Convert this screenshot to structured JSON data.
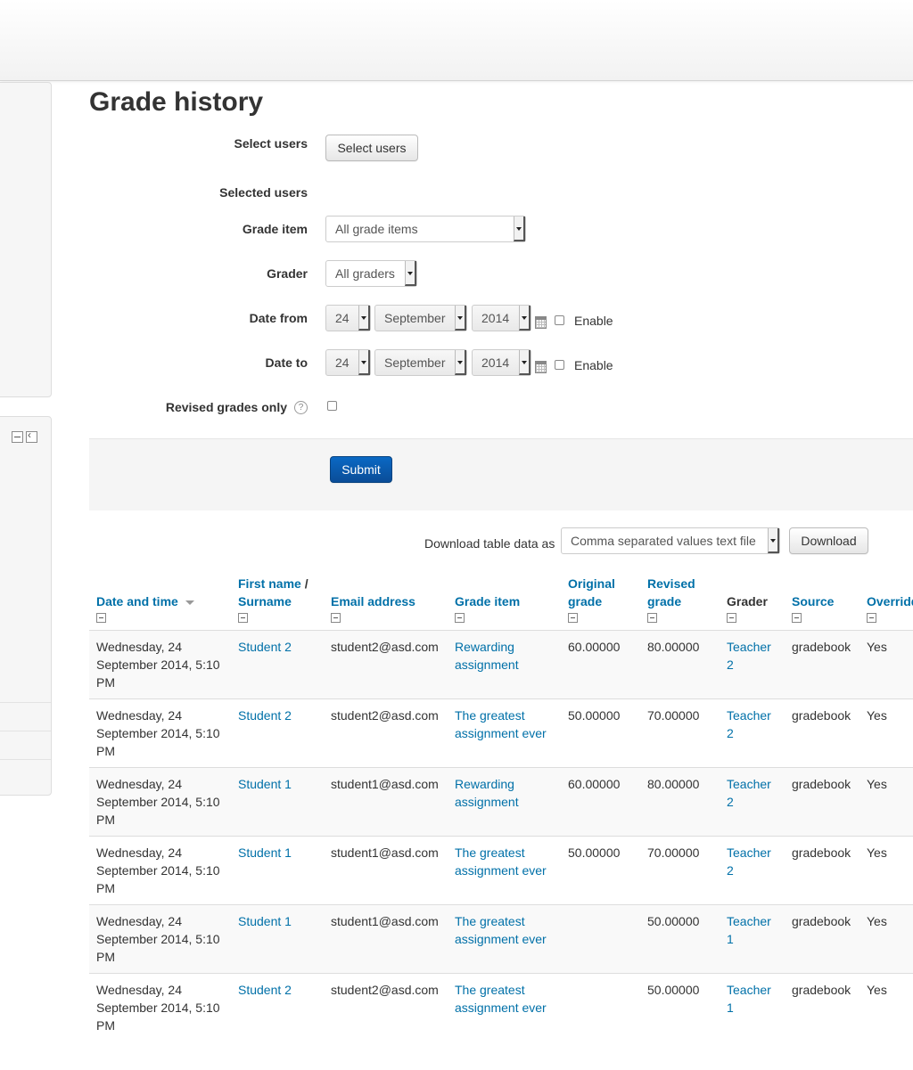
{
  "page": {
    "title": "Grade history"
  },
  "form": {
    "select_users_label": "Select users",
    "select_users_button": "Select users",
    "selected_users_label": "Selected users",
    "grade_item_label": "Grade item",
    "grade_item_value": "All grade items",
    "grader_label": "Grader",
    "grader_value": "All graders",
    "date_from_label": "Date from",
    "date_from": {
      "day": "24",
      "month": "September",
      "year": "2014",
      "enable_label": "Enable"
    },
    "date_to_label": "Date to",
    "date_to": {
      "day": "24",
      "month": "September",
      "year": "2014",
      "enable_label": "Enable"
    },
    "revised_grades_label": "Revised grades only",
    "help_icon": "?",
    "submit_label": "Submit"
  },
  "download": {
    "label": "Download table data as",
    "format_value": "Comma separated values text file",
    "button": "Download"
  },
  "table": {
    "headers": {
      "date": "Date and time",
      "name_first": "First name",
      "name_sep": " /",
      "name_last": "Surname",
      "email": "Email address",
      "item": "Grade item",
      "original": "Original grade",
      "revised": "Revised grade",
      "grader": "Grader",
      "source": "Source",
      "overridden": "Overridden"
    },
    "rows": [
      {
        "date": "Wednesday, 24 September 2014, 5:10 PM",
        "name": "Student 2",
        "email": "student2@asd.com",
        "item": "Rewarding assignment",
        "original": "60.00000",
        "revised": "80.00000",
        "grader": "Teacher 2",
        "source": "gradebook",
        "overridden": "Yes"
      },
      {
        "date": "Wednesday, 24 September 2014, 5:10 PM",
        "name": "Student 2",
        "email": "student2@asd.com",
        "item": "The greatest assignment ever",
        "original": "50.00000",
        "revised": "70.00000",
        "grader": "Teacher 2",
        "source": "gradebook",
        "overridden": "Yes"
      },
      {
        "date": "Wednesday, 24 September 2014, 5:10 PM",
        "name": "Student 1",
        "email": "student1@asd.com",
        "item": "Rewarding assignment",
        "original": "60.00000",
        "revised": "80.00000",
        "grader": "Teacher 2",
        "source": "gradebook",
        "overridden": "Yes"
      },
      {
        "date": "Wednesday, 24 September 2014, 5:10 PM",
        "name": "Student 1",
        "email": "student1@asd.com",
        "item": "The greatest assignment ever",
        "original": "50.00000",
        "revised": "70.00000",
        "grader": "Teacher 2",
        "source": "gradebook",
        "overridden": "Yes"
      },
      {
        "date": "Wednesday, 24 September 2014, 5:10 PM",
        "name": "Student 1",
        "email": "student1@asd.com",
        "item": "The greatest assignment ever",
        "original": "",
        "revised": "50.00000",
        "grader": "Teacher 1",
        "source": "gradebook",
        "overridden": "Yes"
      },
      {
        "date": "Wednesday, 24 September 2014, 5:10 PM",
        "name": "Student 2",
        "email": "student2@asd.com",
        "item": "The greatest assignment ever",
        "original": "",
        "revised": "50.00000",
        "grader": "Teacher 1",
        "source": "gradebook",
        "overridden": "Yes"
      }
    ]
  }
}
